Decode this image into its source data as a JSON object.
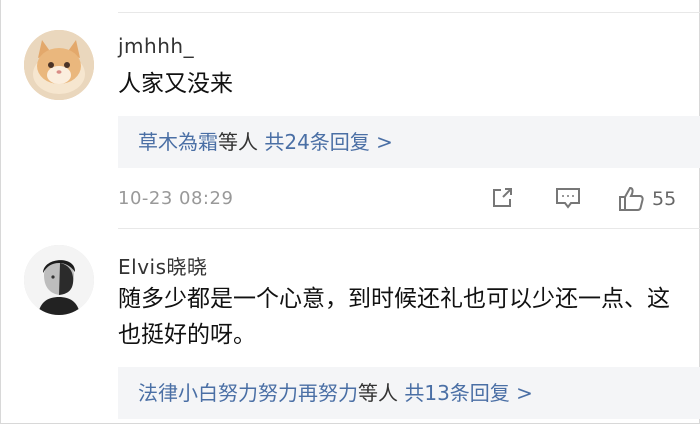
{
  "comments": [
    {
      "username": "jmhhh_",
      "text": "人家又没来",
      "reply_names": "草木為霜",
      "reply_mid": "等人 ",
      "reply_count": "共24条回复 >",
      "timestamp": "10-23 08:29",
      "likes": "55"
    },
    {
      "username": "Elvis晓晓",
      "text": "随多少都是一个心意，到时候还礼也可以少还一点、这也挺好的呀。",
      "reply_names": "法律小白努力努力再努力",
      "reply_mid": "等人 ",
      "reply_count": "共13条回复 >"
    }
  ],
  "icons": [
    "share-icon",
    "comment-icon",
    "like-icon"
  ],
  "colors": {
    "link": "#4a6fa5",
    "meta": "#999999",
    "reply_bg": "#f4f5f7"
  }
}
